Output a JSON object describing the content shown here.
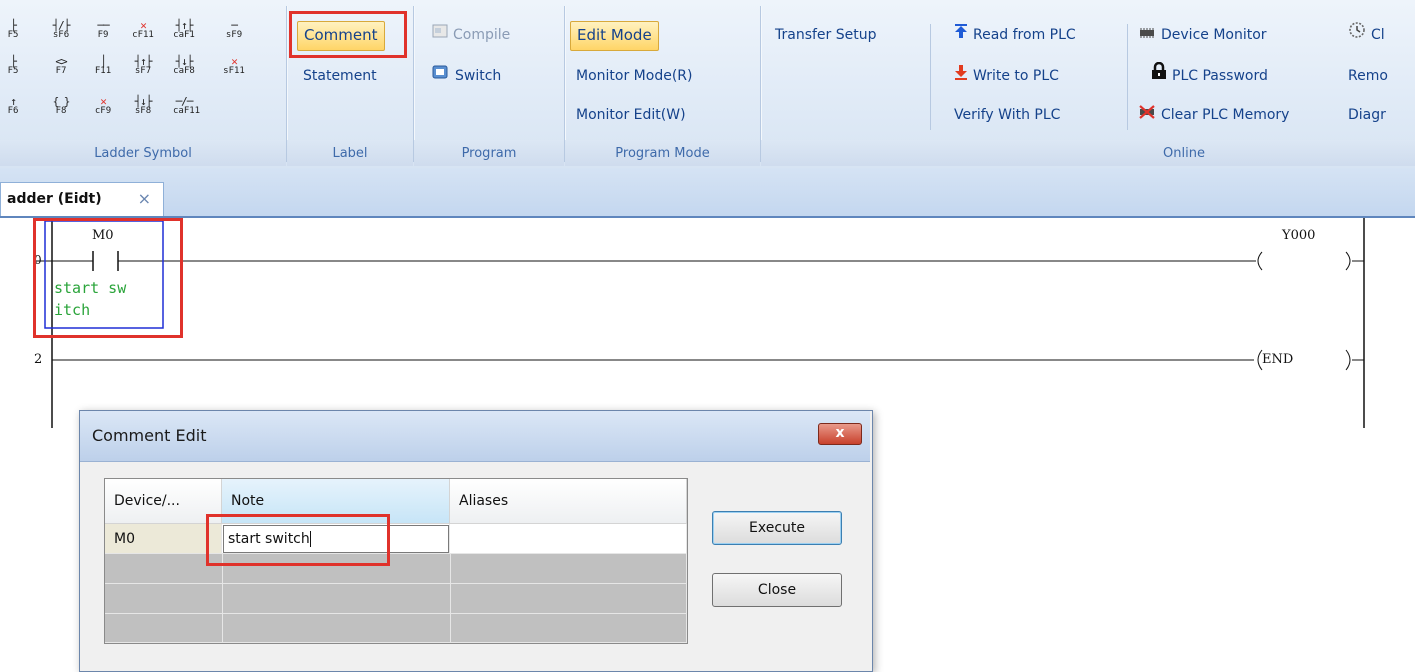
{
  "ribbon": {
    "ladder_symbol": {
      "label": "Ladder Symbol",
      "rows": [
        [
          {
            "g": "├",
            "k": "F5"
          },
          {
            "g": "┤/├",
            "k": "sF6"
          },
          {
            "g": "──",
            "k": "F9"
          },
          {
            "g": "✕",
            "k": "cF11",
            "red": true
          },
          {
            "g": "┤↑├",
            "k": "caF1"
          },
          {
            "g": "─",
            "k": "sF9"
          }
        ],
        [
          {
            "g": "├",
            "k": "F5"
          },
          {
            "g": "<>",
            "k": "F7"
          },
          {
            "g": "│",
            "k": "F11"
          },
          {
            "g": "┤↑├",
            "k": "sF7"
          },
          {
            "g": "┤↓├",
            "k": "caF8"
          },
          {
            "g": "✕",
            "k": "sF11",
            "red": true
          }
        ],
        [
          {
            "g": "↑",
            "k": "F6"
          },
          {
            "g": "{ }",
            "k": "F8"
          },
          {
            "g": "✕",
            "k": "cF9",
            "red": true
          },
          {
            "g": "┤↓├",
            "k": "sF8"
          },
          {
            "g": "─/─",
            "k": "caF11"
          }
        ]
      ]
    },
    "label_group": {
      "label": "Label",
      "comment": "Comment",
      "statement": "Statement"
    },
    "program_group": {
      "label": "Program",
      "compile": "Compile",
      "switch": "Switch"
    },
    "mode_group": {
      "label": "Program Mode",
      "edit": "Edit Mode",
      "monitor": "Monitor Mode(R)",
      "monitor_edit": "Monitor Edit(W)"
    },
    "online_group": {
      "label": "Online",
      "transfer_setup": "Transfer Setup",
      "read": "Read from PLC",
      "write": "Write to PLC",
      "verify": "Verify With PLC",
      "device_monitor": "Device Monitor",
      "plc_password": "PLC Password",
      "clear_memory": "Clear PLC Memory",
      "clock": "Cl",
      "remote": "Remo",
      "diag": "Diagr"
    }
  },
  "tab": {
    "label": "adder (Eidt)",
    "close": "×"
  },
  "ladder": {
    "rung0_num": "0",
    "contact_device": "M0",
    "contact_comment_line1": "start sw",
    "contact_comment_line2": "itch",
    "coil_device": "Y000",
    "rung2_num": "2",
    "end_label": "END"
  },
  "dialog": {
    "title": "Comment Edit",
    "close_glyph": "x",
    "columns": [
      "Device/...",
      "Note",
      "Aliases"
    ],
    "row": {
      "device": "M0",
      "note": "start switch",
      "aliases": ""
    },
    "execute": "Execute",
    "close": "Close"
  },
  "colors": {
    "highlight": "#e0322b",
    "comment_text": "#2aa43a",
    "ribbon_text": "#15428b"
  },
  "icons": [
    "compile-icon",
    "switch-icon",
    "read-arrow-icon",
    "write-arrow-icon",
    "device-monitor-icon",
    "lock-icon",
    "clear-memory-icon",
    "clock-icon",
    "dialog-close-icon"
  ]
}
